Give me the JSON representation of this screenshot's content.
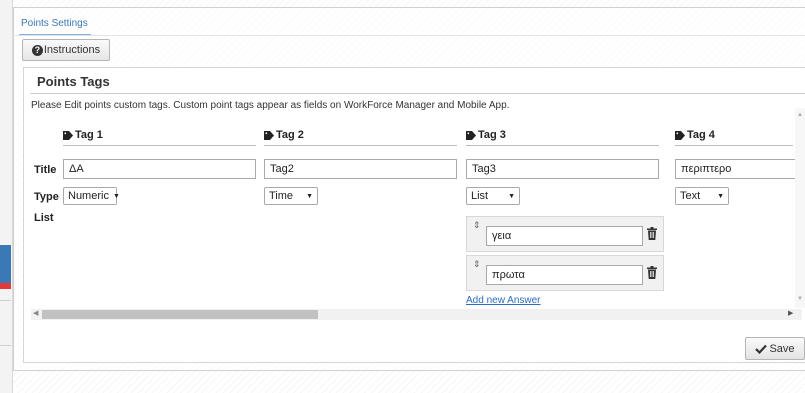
{
  "tab": {
    "label": "Points Settings"
  },
  "instructions_button": {
    "label": "Instructions",
    "icon": "question-circle-icon"
  },
  "section": {
    "title": "Points Tags",
    "description": "Please Edit points custom tags. Custom point tags appear as fields on WorkForce Manager and Mobile App."
  },
  "row_labels": {
    "title": "Title",
    "type": "Type",
    "list": "List"
  },
  "tags": [
    {
      "header": "Tag 1",
      "title_value": "ΔΑ",
      "type_value": "Numeric"
    },
    {
      "header": "Tag 2",
      "title_value": "Tag2",
      "type_value": "Time"
    },
    {
      "header": "Tag 3",
      "title_value": "Tag3",
      "type_value": "List",
      "answers": [
        "γεια",
        "πρωτα"
      ],
      "add_answer_label": "Add new Answer"
    },
    {
      "header": "Tag 4",
      "title_value": "περιπτερο",
      "type_value": "Text"
    }
  ],
  "save_button": {
    "label": "Save",
    "icon": "check-icon"
  },
  "colors": {
    "accent": "#3a78b6",
    "link": "#2a6cc1",
    "sidebar_red": "#e23a3a"
  }
}
